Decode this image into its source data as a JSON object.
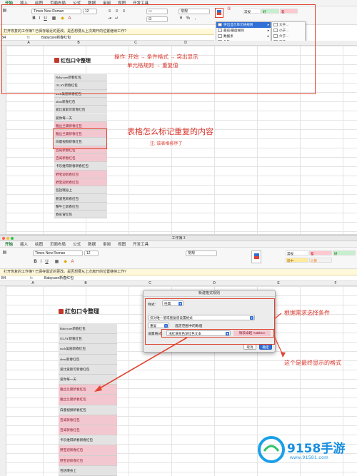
{
  "ribbon_tabs_1": [
    "开始",
    "插入",
    "绘图",
    "页面布局",
    "公式",
    "数据",
    "审阅",
    "视图",
    "开发工具"
  ],
  "ribbon_tabs_2": [
    "开始",
    "插入",
    "绘图",
    "页面布局",
    "公式",
    "数据",
    "审阅",
    "视图",
    "开发工具"
  ],
  "window_title_2": "工作簿 3",
  "font_name": "Times New Roman",
  "font_size": "12",
  "number_format": "常规",
  "style_labels": [
    "常规",
    "好",
    "差",
    "适中",
    "计算"
  ],
  "recovery_notice": "打开恢复的工作簿? 已保存最近的更改。是否想要从上次离开的位置继续工作?",
  "cell_ref_1": "B4",
  "cell_ref_2": "B4",
  "formula_value": "Babycare新春红包",
  "col_headers": [
    "A",
    "B",
    "C",
    "D",
    "E",
    "F"
  ],
  "sheet_title": "红包口令整理",
  "cells_panel1": [
    {
      "text": "Babycare新春红包",
      "dup": false
    },
    {
      "text": "OLAY新春红包",
      "dup": false
    },
    {
      "text": "usch美丽新春红包",
      "dup": false
    },
    {
      "text": "alma新春红包",
      "dup": false
    },
    {
      "text": "爱比爱斯可新春红包",
      "dup": false
    },
    {
      "text": "爱你每一天",
      "dup": false
    },
    {
      "text": "雅丝兰黛新春红包",
      "dup": true
    },
    {
      "text": "雅丝兰黛新春红包",
      "dup": true
    },
    {
      "text": "白鹿视频新春红包",
      "dup": false
    },
    {
      "text": "百威新春红包",
      "dup": true
    },
    {
      "text": "百威新春红包",
      "dup": true
    },
    {
      "text": "卡乐维得新春新春红包",
      "dup": false
    },
    {
      "text": "野宝迎新春红包",
      "dup": true
    },
    {
      "text": "野宝迎新春红包",
      "dup": true
    },
    {
      "text": "包括哦身上",
      "dup": false
    },
    {
      "text": "鲍波克新春红包",
      "dup": false
    },
    {
      "text": "蟹牛土新春红包",
      "dup": false
    },
    {
      "text": "春彩冒红包",
      "dup": false
    }
  ],
  "cells_panel2": [
    {
      "text": "Babycare新春红包",
      "dup": false
    },
    {
      "text": "OLAY新春红包",
      "dup": false
    },
    {
      "text": "usch美丽新春红包",
      "dup": false
    },
    {
      "text": "alma新春红包",
      "dup": false
    },
    {
      "text": "爱比爱斯可新春红包",
      "dup": false
    },
    {
      "text": "爱你每一天",
      "dup": false
    },
    {
      "text": "雅丝兰黛新春红包",
      "dup": true
    },
    {
      "text": "雅丝兰黛新春红包",
      "dup": true
    },
    {
      "text": "白鹿视频新春红包",
      "dup": false
    },
    {
      "text": "百威新春红包",
      "dup": true
    },
    {
      "text": "百威新春红包",
      "dup": true
    },
    {
      "text": "卡乐维得新春新春红包",
      "dup": false
    },
    {
      "text": "野宝迎新春红包",
      "dup": true
    },
    {
      "text": "野宝迎新春红包",
      "dup": true
    },
    {
      "text": "包括哦身上",
      "dup": false
    }
  ],
  "annotations": {
    "step_marker": "②",
    "operation_line1": "操作: 开始 → 条件格式 → 突出显示",
    "operation_line2": "单元格规则 → 重复值",
    "question": "表格怎么标记重复的内容",
    "note": "注: 该表格排序了",
    "choose_condition": "根据需求选择条件",
    "final_format": "这个是最终显示的格式"
  },
  "cf_menu": [
    {
      "label": "突出显示单元格规则",
      "hl": true
    },
    {
      "label": "最前/最后规则",
      "hl": false
    },
    {
      "label": "数据条",
      "hl": false
    },
    {
      "label": "色阶",
      "hl": false
    },
    {
      "label": "图标集",
      "hl": false
    },
    {
      "label": "新建规则...",
      "hl": false
    },
    {
      "label": "清除规则",
      "hl": false
    },
    {
      "label": "管理规则...",
      "hl": false
    }
  ],
  "highlight_submenu": [
    {
      "label": "大于...",
      "hl": false
    },
    {
      "label": "小于...",
      "hl": false
    },
    {
      "label": "介于...",
      "hl": false
    },
    {
      "label": "等于...",
      "hl": false
    },
    {
      "label": "文本包含...",
      "hl": false
    },
    {
      "label": "发生日期...",
      "hl": false
    },
    {
      "label": "重复值...",
      "hl": true
    },
    {
      "label": "其他规则...",
      "hl": false
    }
  ],
  "dialog": {
    "title": "新建格式规则",
    "style_label": "样式:",
    "style_value": "经典",
    "rule_type": "仅对唯一值或重复值设置格式",
    "dup_value": "重复",
    "range_text": "选定范围中的数值",
    "format_label": "设置格式:",
    "format_value": "浅红填充色深红色文本",
    "preview": "微软卓越 AaBbCc",
    "cancel": "取消",
    "ok": "确定"
  },
  "watermark": {
    "brand": "9158手游",
    "url": "www.91581.com"
  },
  "colors": {
    "accent_red": "#e0432f",
    "dup_fill": "#f3c7cf",
    "dup_text": "#8b1a2e",
    "excel_green": "#1f7a3a",
    "menu_highlight": "#2f6fd6"
  }
}
